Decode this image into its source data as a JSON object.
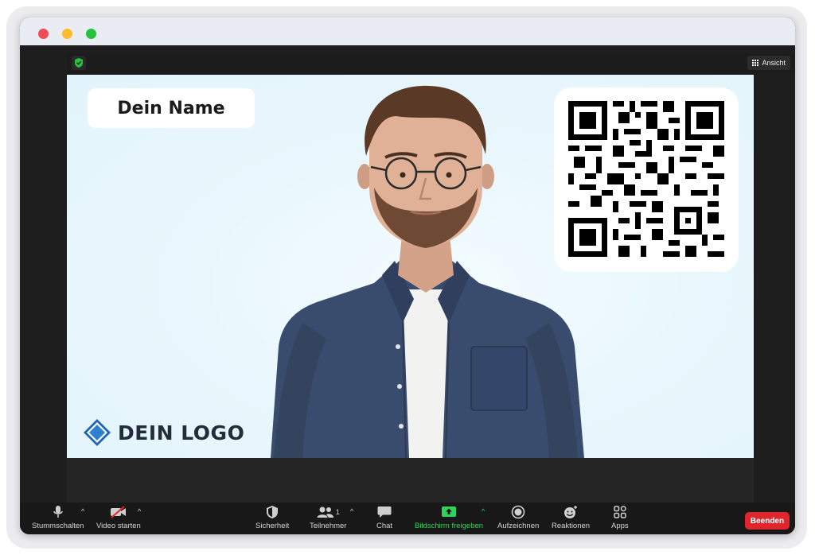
{
  "window": {
    "colors": {
      "close": "#f04b57",
      "minimize": "#fdbc2e",
      "maximize": "#27c23f"
    }
  },
  "topbar": {
    "security_badge_icon": "shield-check-icon",
    "view_icon": "grid-icon",
    "view_label": "Ansicht"
  },
  "stage": {
    "name_card": "Dein Name",
    "logo_text": "DEIN LOGO",
    "logo_icon": "diamond-icon",
    "qr_icon": "qr-code-icon"
  },
  "toolbar": {
    "mute_label": "Stummschalten",
    "video_label": "Video starten",
    "security_label": "Sicherheit",
    "participants_label": "Teilnehmer",
    "participants_count": "1",
    "chat_label": "Chat",
    "share_label": "Bildschirm freigeben",
    "record_label": "Aufzeichnen",
    "reactions_label": "Reaktionen",
    "apps_label": "Apps",
    "end_label": "Beenden",
    "colors": {
      "share_accent": "#2fd35b",
      "end_button": "#e0262d"
    }
  }
}
